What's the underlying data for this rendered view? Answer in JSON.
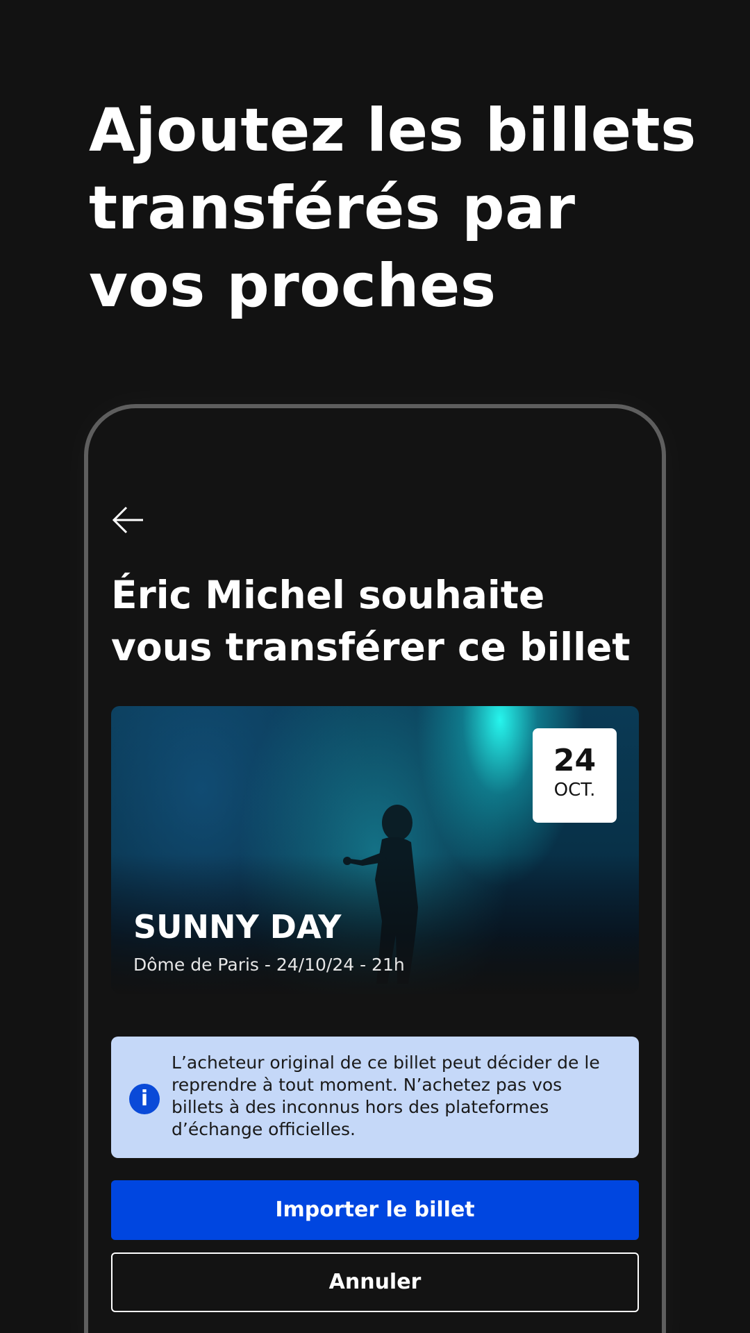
{
  "promo": {
    "headline_lines": [
      "Ajoutez les billets",
      "transférés par",
      "vos proches"
    ]
  },
  "screen": {
    "back_icon": "arrow-left-icon",
    "title_lines": [
      "Éric Michel souhaite",
      "vous transférer ce billet"
    ],
    "event": {
      "date_day": "24",
      "date_month": "OCT.",
      "name": "SUNNY DAY",
      "details": "Dôme de Paris - 24/10/24 - 21h"
    },
    "info": {
      "icon": "info-icon",
      "text_lines": [
        "L’acheteur original de ce billet peut décider de le",
        "reprendre à tout moment. N’achetez pas vos",
        "billets à des inconnus hors des plateformes",
        "d’échange officielles."
      ]
    },
    "actions": {
      "primary_label": "Importer le billet",
      "secondary_label": "Annuler"
    }
  },
  "colors": {
    "background": "#121212",
    "accent": "#0046E0",
    "info_background": "#C5D8F8",
    "phone_frame": "#5E5E5E"
  }
}
